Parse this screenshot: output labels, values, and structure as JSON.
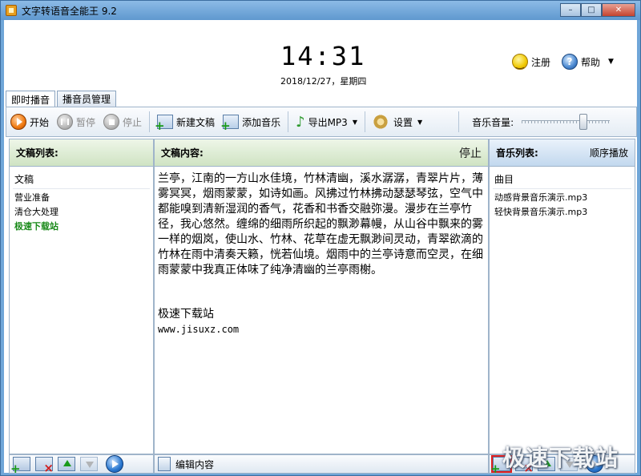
{
  "window": {
    "title": "文字转语音全能王 9.2",
    "minimize": "–",
    "maximize": "□",
    "close": "✕"
  },
  "header": {
    "clock": "14:31",
    "date": "2018/12/27，星期四",
    "register_label": "注册",
    "help_label": "帮助",
    "help_caret": "▼"
  },
  "tabs": [
    {
      "label": "即时播音",
      "active": true
    },
    {
      "label": "播音员管理",
      "active": false
    }
  ],
  "toolbar": {
    "start": "开始",
    "pause": "暂停",
    "stop": "停止",
    "new_doc": "新建文稿",
    "add_music": "添加音乐",
    "export_mp3": "导出MP3",
    "settings": "设置",
    "caret": "▼",
    "volume_label": "音乐音量:",
    "volume_level": 0.72
  },
  "left_panel": {
    "title": "文稿列表:",
    "column": "文稿",
    "items": [
      "营业准备",
      "清仓大处理",
      "极速下载站"
    ]
  },
  "center_panel": {
    "title": "文稿内容:",
    "status": "停止",
    "body": "兰亭，江南的一方山水佳境，竹林清幽，溪水潺潺，青翠片片，薄雾冥冥，烟雨蒙蒙，如诗如画。风拂过竹林拂动瑟瑟琴弦，空气中都能嗅到清新湿润的香气，花香和书香交融弥漫。漫步在兰亭竹径，我心悠然。缠绵的细雨所织起的飘渺幕幔，从山谷中飘来的雾一样的烟岚，使山水、竹林、花草在虚无飘渺间灵动，青翠欲滴的竹林在雨中清奏天籁，恍若仙境。烟雨中的兰亭诗意而空灵，在细雨蒙蒙中我真正体味了纯净清幽的兰亭雨榭。",
    "footer_name": "极速下载站",
    "footer_url": "www.jisuxz.com"
  },
  "right_panel": {
    "title": "音乐列表:",
    "mode": "顺序播放",
    "column": "曲目",
    "items": [
      "动感背景音乐演示.mp3",
      "轻快背景音乐演示.mp3"
    ]
  },
  "bottom": {
    "edit_label": "编辑内容"
  },
  "watermark": "极速下载站"
}
